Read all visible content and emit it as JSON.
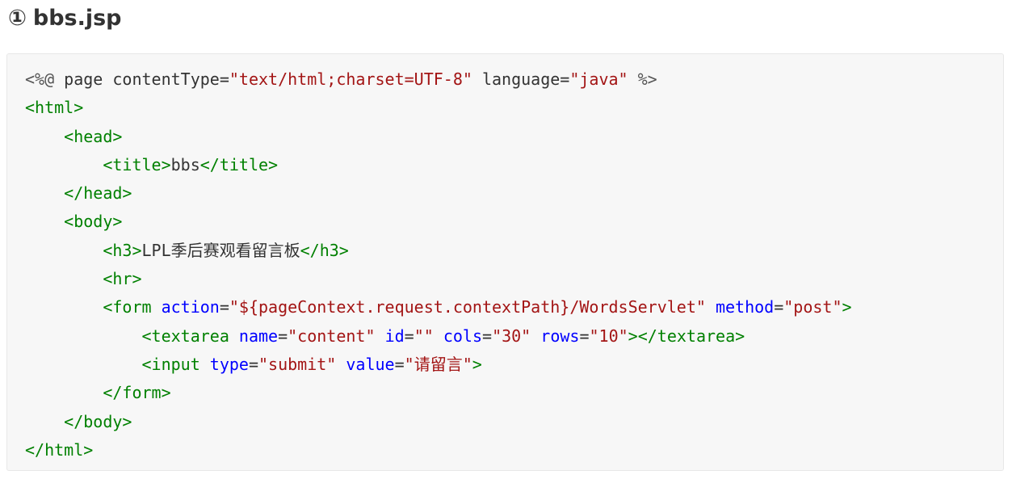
{
  "heading": {
    "number": "①",
    "title": "bbs.jsp"
  },
  "code": {
    "language": "jsp",
    "colors": {
      "tag": "#008000",
      "attr": "#0000ff",
      "str": "#a31515",
      "text": "#333333",
      "dir": "#555555"
    },
    "lines": [
      [
        [
          "dir",
          "<%@"
        ],
        [
          "text",
          " page contentType"
        ],
        [
          "text",
          "="
        ],
        [
          "str",
          "\"text/html;charset=UTF-8\""
        ],
        [
          "text",
          " language"
        ],
        [
          "text",
          "="
        ],
        [
          "str",
          "\"java\""
        ],
        [
          "dir",
          " %>"
        ]
      ],
      [
        [
          "tag",
          "<html>"
        ]
      ],
      [
        [
          "text",
          "    "
        ],
        [
          "tag",
          "<head>"
        ]
      ],
      [
        [
          "text",
          "        "
        ],
        [
          "tag",
          "<title>"
        ],
        [
          "text",
          "bbs"
        ],
        [
          "tag",
          "</title>"
        ]
      ],
      [
        [
          "text",
          "    "
        ],
        [
          "tag",
          "</head>"
        ]
      ],
      [
        [
          "text",
          "    "
        ],
        [
          "tag",
          "<body>"
        ]
      ],
      [
        [
          "text",
          "        "
        ],
        [
          "tag",
          "<h3>"
        ],
        [
          "text",
          "LPL季后赛观看留言板"
        ],
        [
          "tag",
          "</h3>"
        ]
      ],
      [
        [
          "text",
          "        "
        ],
        [
          "tag",
          "<hr>"
        ]
      ],
      [
        [
          "text",
          "        "
        ],
        [
          "tag",
          "<form"
        ],
        [
          "text",
          " "
        ],
        [
          "attr",
          "action"
        ],
        [
          "text",
          "="
        ],
        [
          "str",
          "\"${pageContext.request.contextPath}/WordsServlet\""
        ],
        [
          "text",
          " "
        ],
        [
          "attr",
          "method"
        ],
        [
          "text",
          "="
        ],
        [
          "str",
          "\"post\""
        ],
        [
          "tag",
          ">"
        ]
      ],
      [
        [
          "text",
          "            "
        ],
        [
          "tag",
          "<textarea"
        ],
        [
          "text",
          " "
        ],
        [
          "attr",
          "name"
        ],
        [
          "text",
          "="
        ],
        [
          "str",
          "\"content\""
        ],
        [
          "text",
          " "
        ],
        [
          "attr",
          "id"
        ],
        [
          "text",
          "="
        ],
        [
          "str",
          "\"\""
        ],
        [
          "text",
          " "
        ],
        [
          "attr",
          "cols"
        ],
        [
          "text",
          "="
        ],
        [
          "str",
          "\"30\""
        ],
        [
          "text",
          " "
        ],
        [
          "attr",
          "rows"
        ],
        [
          "text",
          "="
        ],
        [
          "str",
          "\"10\""
        ],
        [
          "tag",
          "></textarea>"
        ]
      ],
      [
        [
          "text",
          "            "
        ],
        [
          "tag",
          "<input"
        ],
        [
          "text",
          " "
        ],
        [
          "attr",
          "type"
        ],
        [
          "text",
          "="
        ],
        [
          "str",
          "\"submit\""
        ],
        [
          "text",
          " "
        ],
        [
          "attr",
          "value"
        ],
        [
          "text",
          "="
        ],
        [
          "str",
          "\"请留言\""
        ],
        [
          "tag",
          ">"
        ]
      ],
      [
        [
          "text",
          "        "
        ],
        [
          "tag",
          "</form>"
        ]
      ],
      [
        [
          "text",
          "    "
        ],
        [
          "tag",
          "</body>"
        ]
      ],
      [
        [
          "tag",
          "</html>"
        ]
      ]
    ]
  }
}
